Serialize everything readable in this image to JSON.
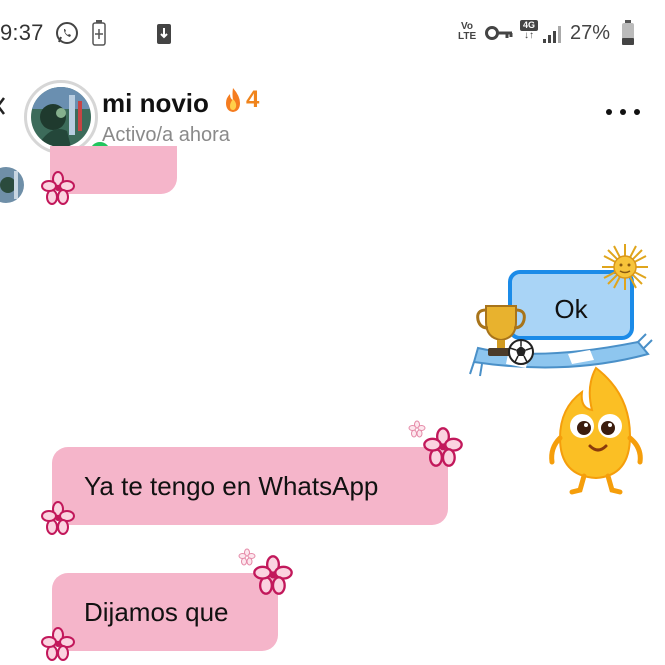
{
  "status_bar": {
    "time": "9:37",
    "network_label": "Vo LTE",
    "data_label": "4G",
    "battery_percent": "27%"
  },
  "header": {
    "contact_name": "mi novio",
    "streak_count": "4",
    "status_text": "Activo/a ahora"
  },
  "messages": [
    {
      "side": "sent",
      "text": "Ok",
      "style": "blue-bordered"
    },
    {
      "side": "received",
      "text": "Ya te tengo en WhatsApp"
    },
    {
      "side": "received",
      "text": "Dijamos que"
    }
  ],
  "icons": {
    "status_left": [
      "whatsapp-icon",
      "battery-saver-icon",
      "download-icon"
    ],
    "status_right": [
      "volte-icon",
      "vpn-key-icon",
      "4g-icon",
      "signal-icon",
      "battery-icon"
    ],
    "header": [
      "fire-icon",
      "more-options-icon"
    ],
    "stickers": [
      "argentina-sun-icon",
      "trophy-icon",
      "soccer-ball-icon",
      "flame-mascot-icon"
    ],
    "decorations": [
      "flower-icon"
    ]
  },
  "colors": {
    "received_bubble": "#f5b5ca",
    "sent_bubble": "#a9d4f6",
    "sent_border": "#1b8be8",
    "online": "#22c55e",
    "streak": "#f0841c",
    "flower": "#c2185b"
  }
}
